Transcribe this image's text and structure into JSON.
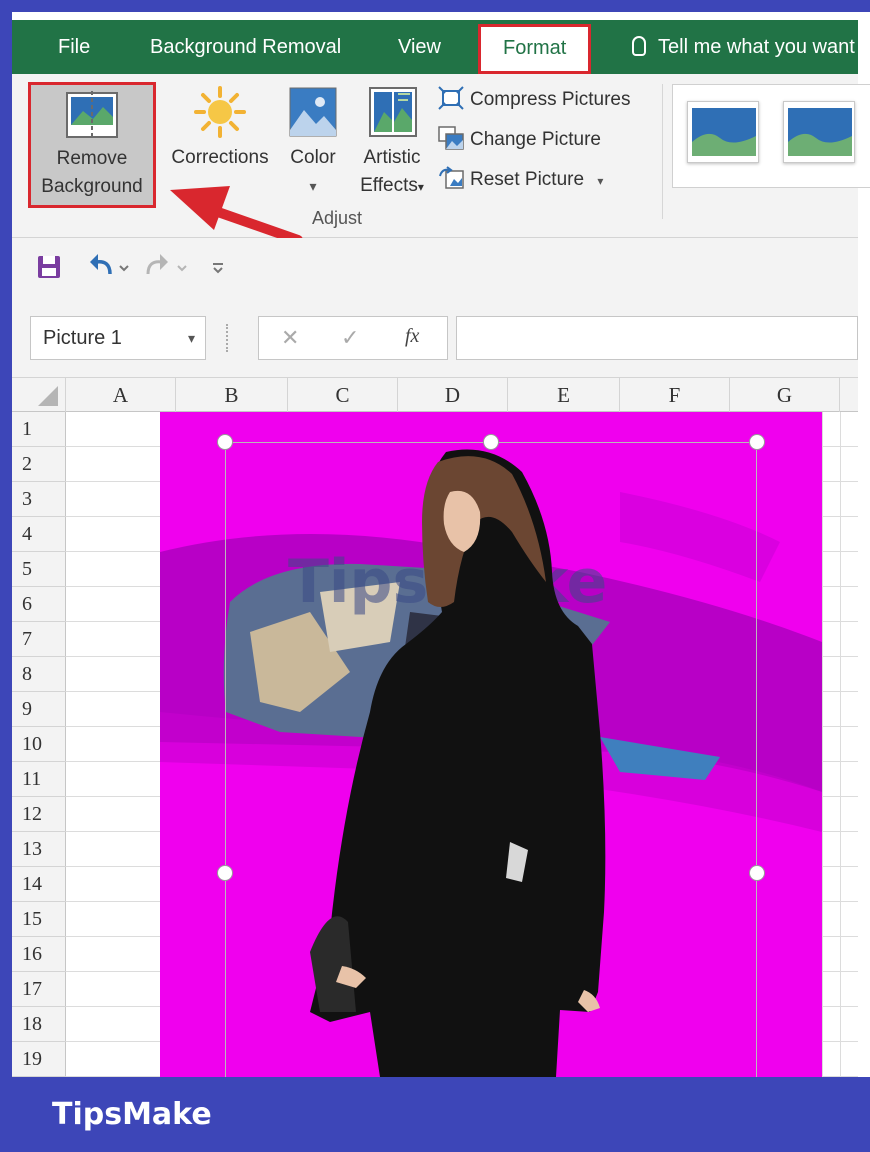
{
  "tabs": {
    "file": "File",
    "background_removal": "Background Removal",
    "view": "View",
    "format": "Format",
    "tell_me": "Tell me what you want"
  },
  "ribbon": {
    "remove_background_line1": "Remove",
    "remove_background_line2": "Background",
    "corrections": "Corrections",
    "color": "Color",
    "artistic_line1": "Artistic",
    "artistic_line2": "Effects",
    "compress": "Compress Pictures",
    "change": "Change Picture",
    "reset": "Reset Picture",
    "group_adjust": "Adjust",
    "dropdown_glyph": "▾"
  },
  "namebox": {
    "value": "Picture 1"
  },
  "formula": {
    "fx": "fx",
    "cancel": "✕",
    "enter": "✓"
  },
  "columns": [
    "A",
    "B",
    "C",
    "D",
    "E",
    "F",
    "G"
  ],
  "rows": [
    "1",
    "2",
    "3",
    "4",
    "5",
    "6",
    "7",
    "8",
    "9",
    "10",
    "11",
    "12",
    "13",
    "14",
    "15",
    "16",
    "17",
    "18",
    "19"
  ],
  "picture": {
    "watermark": "TipsMake"
  },
  "footer": {
    "brand": "TipsMake"
  },
  "colors": {
    "excel_green": "#217346",
    "highlight_red": "#d9272e",
    "removal_magenta": "#f000ee",
    "frame_blue": "#3d46b8"
  }
}
